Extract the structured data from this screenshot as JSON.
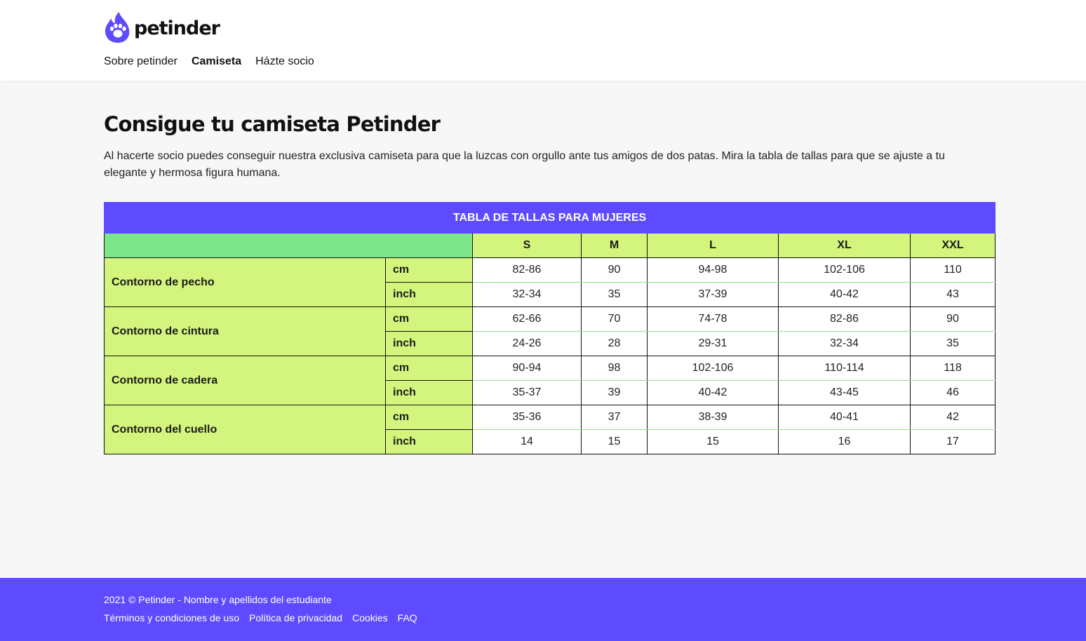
{
  "brand": {
    "name": "petinder",
    "accent_color": "#5e4bff",
    "icon": "flame-paw-icon"
  },
  "nav": {
    "items": [
      {
        "label": "Sobre petinder",
        "active": false
      },
      {
        "label": "Camiseta",
        "active": true
      },
      {
        "label": "Házte socio",
        "active": false
      }
    ]
  },
  "main": {
    "title": "Consigue tu camiseta Petinder",
    "intro": "Al hacerte socio puedes conseguir nuestra exclusiva camiseta para que la luzcas con orgullo ante tus amigos de dos patas. Mira la tabla de tallas para que se ajuste a tu elegante y hermosa figura humana."
  },
  "size_table": {
    "caption": "TABLA DE TALLAS PARA MUJERES",
    "sizes": [
      "S",
      "M",
      "L",
      "XL",
      "XXL"
    ],
    "colors": {
      "caption_bg": "#5e4bff",
      "blank_header_bg": "#7de68a",
      "label_bg": "#d3f57d"
    },
    "measures": [
      {
        "label": "Contorno de pecho",
        "rows": [
          {
            "unit": "cm",
            "values": [
              "82-86",
              "90",
              "94-98",
              "102-106",
              "110"
            ]
          },
          {
            "unit": "inch",
            "values": [
              "32-34",
              "35",
              "37-39",
              "40-42",
              "43"
            ]
          }
        ]
      },
      {
        "label": "Contorno de cintura",
        "rows": [
          {
            "unit": "cm",
            "values": [
              "62-66",
              "70",
              "74-78",
              "82-86",
              "90"
            ]
          },
          {
            "unit": "inch",
            "values": [
              "24-26",
              "28",
              "29-31",
              "32-34",
              "35"
            ]
          }
        ]
      },
      {
        "label": "Contorno de cadera",
        "rows": [
          {
            "unit": "cm",
            "values": [
              "90-94",
              "98",
              "102-106",
              "110-114",
              "118"
            ]
          },
          {
            "unit": "inch",
            "values": [
              "35-37",
              "39",
              "40-42",
              "43-45",
              "46"
            ]
          }
        ]
      },
      {
        "label": "Contorno del cuello",
        "rows": [
          {
            "unit": "cm",
            "values": [
              "35-36",
              "37",
              "38-39",
              "40-41",
              "42"
            ]
          },
          {
            "unit": "inch",
            "values": [
              "14",
              "15",
              "15",
              "16",
              "17"
            ]
          }
        ]
      }
    ]
  },
  "footer": {
    "copyright": "2021 © Petinder - Nombre y apellidos del estudiante",
    "links": [
      "Términos y condiciones de uso",
      "Política de privacidad",
      "Cookies",
      "FAQ"
    ]
  }
}
